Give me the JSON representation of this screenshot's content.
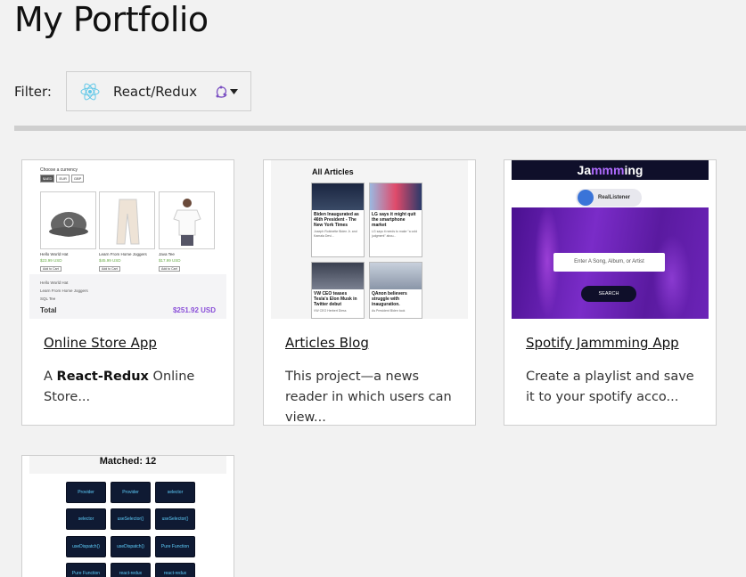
{
  "page": {
    "title": "My Portfolio"
  },
  "filter": {
    "label": "Filter:",
    "selected": "React/Redux",
    "icon": "react-icon",
    "caret_icon": "redux-icon"
  },
  "cards": [
    {
      "title": "Online Store App",
      "desc_prefix": "A ",
      "desc_bold": "React-Redux",
      "desc_suffix": " Online Store...",
      "thumb": {
        "currency_label": "Choose a currency",
        "currencies": [
          "$AED",
          "EUR",
          "GBP"
        ],
        "products": [
          {
            "name": "Hello World Hat",
            "price": "$23.99 USD"
          },
          {
            "name": "Learn From Home Joggers",
            "price": "$45.99 USD"
          },
          {
            "name": "Java Tee",
            "price": "$17.99 USD"
          }
        ],
        "add_label": "Add to Cart",
        "cart_rows": [
          "Hello World Hat",
          "Learn From Home Joggers",
          "SQL Tee"
        ],
        "total_label": "Total",
        "total_value": "$251.92 USD"
      }
    },
    {
      "title": "Articles Blog",
      "desc": "This project—a news reader in which users can view...",
      "thumb": {
        "heading": "All Articles",
        "articles": [
          {
            "title": "Biden Inaugurated as 46th President - The New York Times",
            "sub": "Joseph Robinette Biden Jr. and Kamala Devi..."
          },
          {
            "title": "LG says it might quit the smartphone market",
            "sub": "LG says it needs to make \"a cold judgment\" abou..."
          },
          {
            "title": "VW CEO teases Tesla's Elon Musk in Twitter debut",
            "sub": "VW CEO Herbert Diess"
          },
          {
            "title": "QAnon believers struggle with inauguration.",
            "sub": "As President Biden took"
          }
        ]
      }
    },
    {
      "title": "Spotify Jammming App",
      "desc": "Create a playlist and save it to your spotify acco...",
      "thumb": {
        "brand_a": "Ja",
        "brand_b": "mmm",
        "brand_c": "ing",
        "user": "RealListener",
        "search_placeholder": "Enter A Song, Album, or Artist",
        "search_button": "SEARCH"
      }
    },
    {
      "thumb": {
        "matched": "Matched: 12",
        "tiles": [
          "Provider",
          "Provider",
          "selector",
          "selector",
          "useSelector()",
          "useSelector()",
          "useDispatch()",
          "useDispatch()",
          "Pure Function",
          "Pure Function",
          "react-redux",
          "react-redux"
        ]
      }
    }
  ]
}
